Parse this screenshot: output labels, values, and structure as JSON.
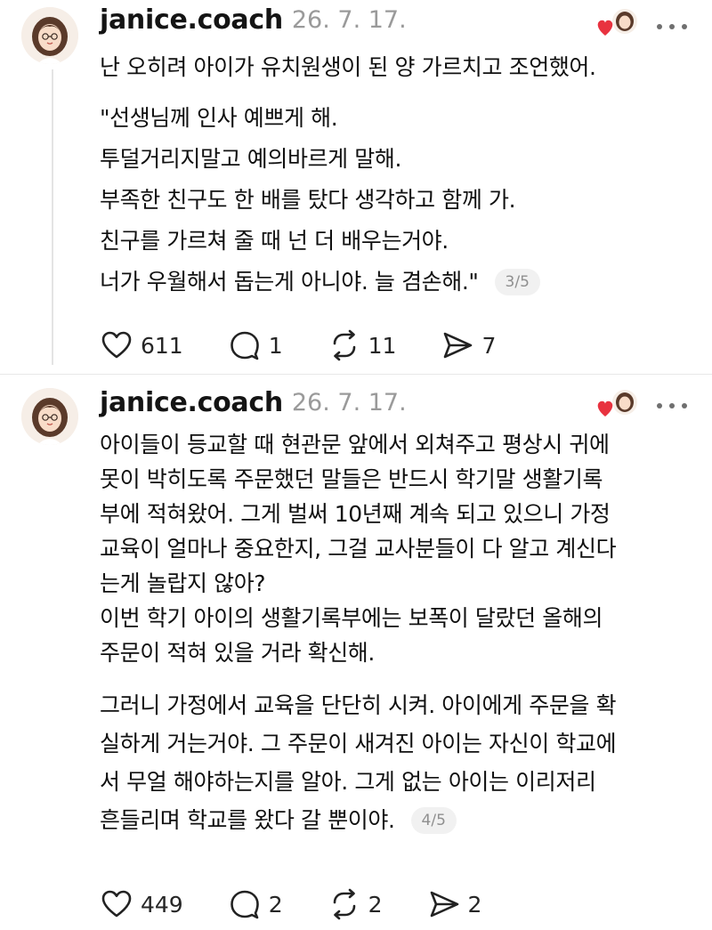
{
  "posts": [
    {
      "username": "janice.coach",
      "date": "26. 7. 17.",
      "paragraphs": [
        [
          "난 오히려 아이가 유치원생이 된 양 가르치고 조언했어."
        ],
        [
          "\"선생님께 인사 예쁘게 해.",
          "투덜거리지말고 예의바르게 말해.",
          "부족한 친구도 한 배를 탔다 생각하고 함께 가.",
          "친구를 가르쳐 줄 때 넌 더 배우는거야.",
          "너가 우월해서 돕는게 아니야. 늘 겸손해.\""
        ]
      ],
      "page_indicator": "3/5",
      "likes": "611",
      "replies": "1",
      "reposts": "11",
      "shares": "7"
    },
    {
      "username": "janice.coach",
      "date": "26. 7. 17.",
      "paragraphs": [
        [
          "아이들이 등교할 때 현관문 앞에서 외쳐주고 평상시 귀에",
          "못이 박히도록 주문했던 말들은 반드시 학기말 생활기록",
          "부에 적혀왔어. 그게 벌써 10년째 계속 되고 있으니 가정",
          "교육이 얼마나 중요한지, 그걸 교사분들이 다 알고 계신다",
          "는게 놀랍지 않아?",
          "이번 학기 아이의 생활기록부에는 보폭이 달랐던 올해의",
          "주문이 적혀 있을 거라 확신해."
        ],
        [
          "그러니 가정에서 교육을 단단히 시켜. 아이에게 주문을 확",
          "실하게 거는거야. 그 주문이 새겨진 아이는 자신이 학교에",
          "서 무얼 해야하는지를 알아. 그게 없는 아이는 이리저리",
          "흔들리며 학교를 왔다 갈 뿐이야."
        ]
      ],
      "page_indicator": "4/5",
      "likes": "449",
      "replies": "2",
      "reposts": "2",
      "shares": "2"
    }
  ],
  "icons": {
    "like": "heart-outline-icon",
    "reply": "speech-bubble-icon",
    "repost": "repost-arrows-icon",
    "share": "send-icon",
    "more": "more-dots-icon",
    "liked_by": "heart-avatar-icon"
  },
  "colors": {
    "heart": "#e8323f",
    "muted": "#9a9a9a"
  }
}
